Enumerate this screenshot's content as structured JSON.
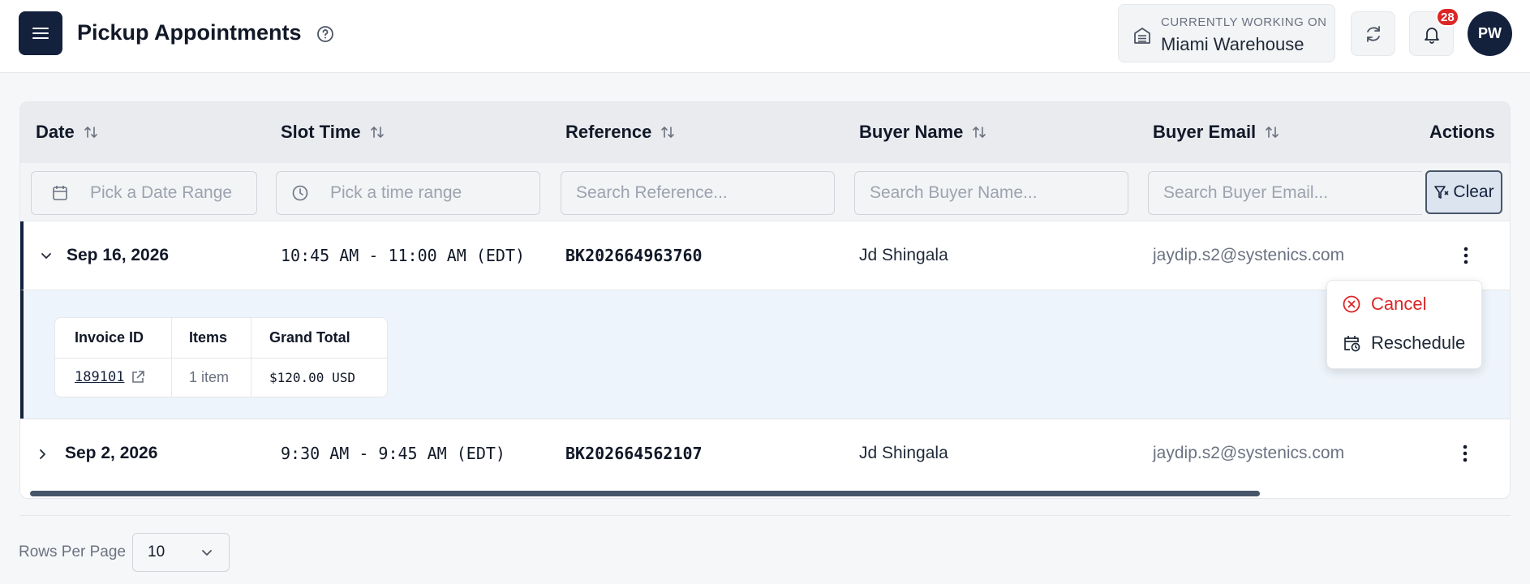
{
  "header": {
    "title": "Pickup Appointments",
    "working_label": "CURRENTLY WORKING ON",
    "working_value": "Miami Warehouse",
    "notification_count": "28",
    "avatar_initials": "PW"
  },
  "table": {
    "columns": [
      "Date",
      "Slot Time",
      "Reference",
      "Buyer Name",
      "Buyer Email",
      "Actions"
    ],
    "filters": {
      "date_placeholder": "Pick a Date Range",
      "time_placeholder": "Pick a time range",
      "reference_placeholder": "Search Reference...",
      "buyer_name_placeholder": "Search Buyer Name...",
      "buyer_email_placeholder": "Search Buyer Email...",
      "clear_label": "Clear"
    },
    "rows": [
      {
        "date": "Sep 16, 2026",
        "slot": "10:45 AM - 11:00 AM (EDT)",
        "reference": "BK202664963760",
        "buyer_name": "Jd Shingala",
        "buyer_email": "jaydip.s2@systenics.com"
      },
      {
        "date": "Sep 2, 2026",
        "slot": "9:30 AM - 9:45 AM (EDT)",
        "reference": "BK202664562107",
        "buyer_name": "Jd Shingala",
        "buyer_email": "jaydip.s2@systenics.com"
      }
    ],
    "expanded": {
      "columns": [
        "Invoice ID",
        "Items",
        "Grand Total"
      ],
      "invoice_id": "189101",
      "items": "1 item",
      "grand_total": "$120.00 USD"
    }
  },
  "actions_menu": {
    "cancel": "Cancel",
    "reschedule": "Reschedule"
  },
  "pagination": {
    "rows_per_page_label": "Rows Per Page",
    "rows_per_page_value": "10"
  },
  "colors": {
    "primary": "#14213d",
    "danger": "#dc2626",
    "expanded_bg": "#eef4fb"
  }
}
